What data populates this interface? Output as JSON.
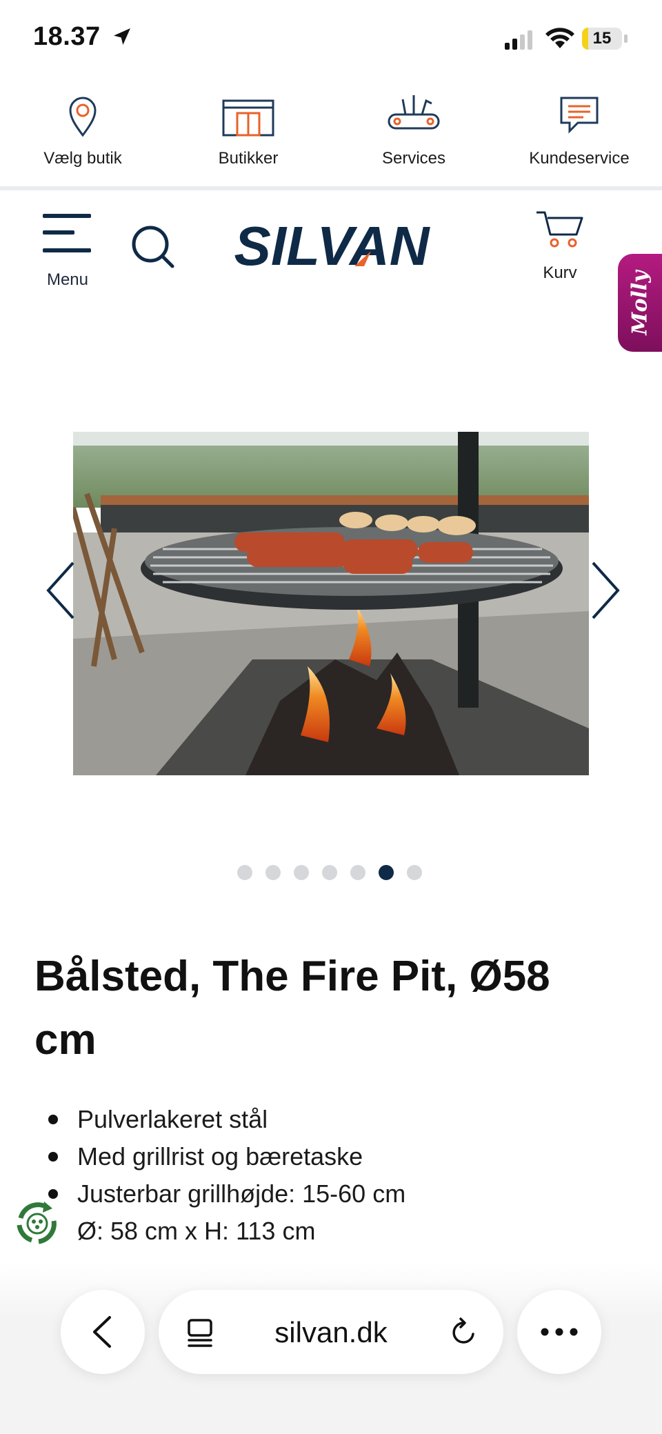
{
  "status_bar": {
    "time": "18.37",
    "battery": "15"
  },
  "top_nav": {
    "items": [
      {
        "label": "Vælg butik",
        "icon": "location-pin-icon"
      },
      {
        "label": "Butikker",
        "icon": "store-icon"
      },
      {
        "label": "Services",
        "icon": "tools-icon"
      },
      {
        "label": "Kundeservice",
        "icon": "chat-icon"
      }
    ]
  },
  "header": {
    "menu_label": "Menu",
    "logo_text": "SILVAN",
    "cart_label": "Kurv",
    "chat_widget": "Molly"
  },
  "carousel": {
    "dot_count": 7,
    "active_index": 5
  },
  "product": {
    "title": "Bålsted, The Fire Pit, Ø58 cm",
    "features": [
      "Pulverlakeret stål",
      "Med grillrist og bæretaske",
      "Justerbar grillhøjde: 15-60 cm",
      "Ø: 58 cm x H: 113 cm"
    ]
  },
  "browser": {
    "url": "silvan.dk"
  },
  "colors": {
    "brand_navy": "#0f2a47",
    "brand_orange": "#e8622b",
    "molly_magenta": "#b41b80"
  }
}
